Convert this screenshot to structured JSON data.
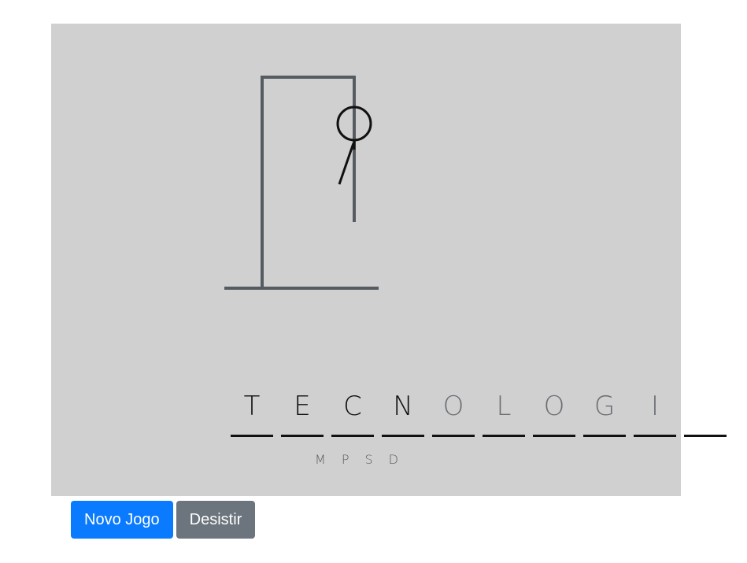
{
  "game": {
    "word_letters": [
      {
        "char": "T",
        "state": "correct"
      },
      {
        "char": "E",
        "state": "correct"
      },
      {
        "char": "C",
        "state": "correct"
      },
      {
        "char": "N",
        "state": "correct"
      },
      {
        "char": "O",
        "state": "revealed"
      },
      {
        "char": "L",
        "state": "revealed"
      },
      {
        "char": "O",
        "state": "revealed"
      },
      {
        "char": "G",
        "state": "revealed"
      },
      {
        "char": "I",
        "state": "revealed"
      },
      {
        "char": "",
        "state": "revealed"
      }
    ],
    "wrong_letters": [
      "M",
      "P",
      "S",
      "D"
    ],
    "body_parts_shown": [
      "head",
      "torso",
      "left-arm"
    ]
  },
  "buttons": {
    "new_game": "Novo Jogo",
    "give_up": "Desistir"
  },
  "colors": {
    "board_bg": "#d0d0d0",
    "gallows": "#555b61",
    "figure": "#111111",
    "primary": "#0a7bff",
    "secondary": "#6c757d"
  }
}
